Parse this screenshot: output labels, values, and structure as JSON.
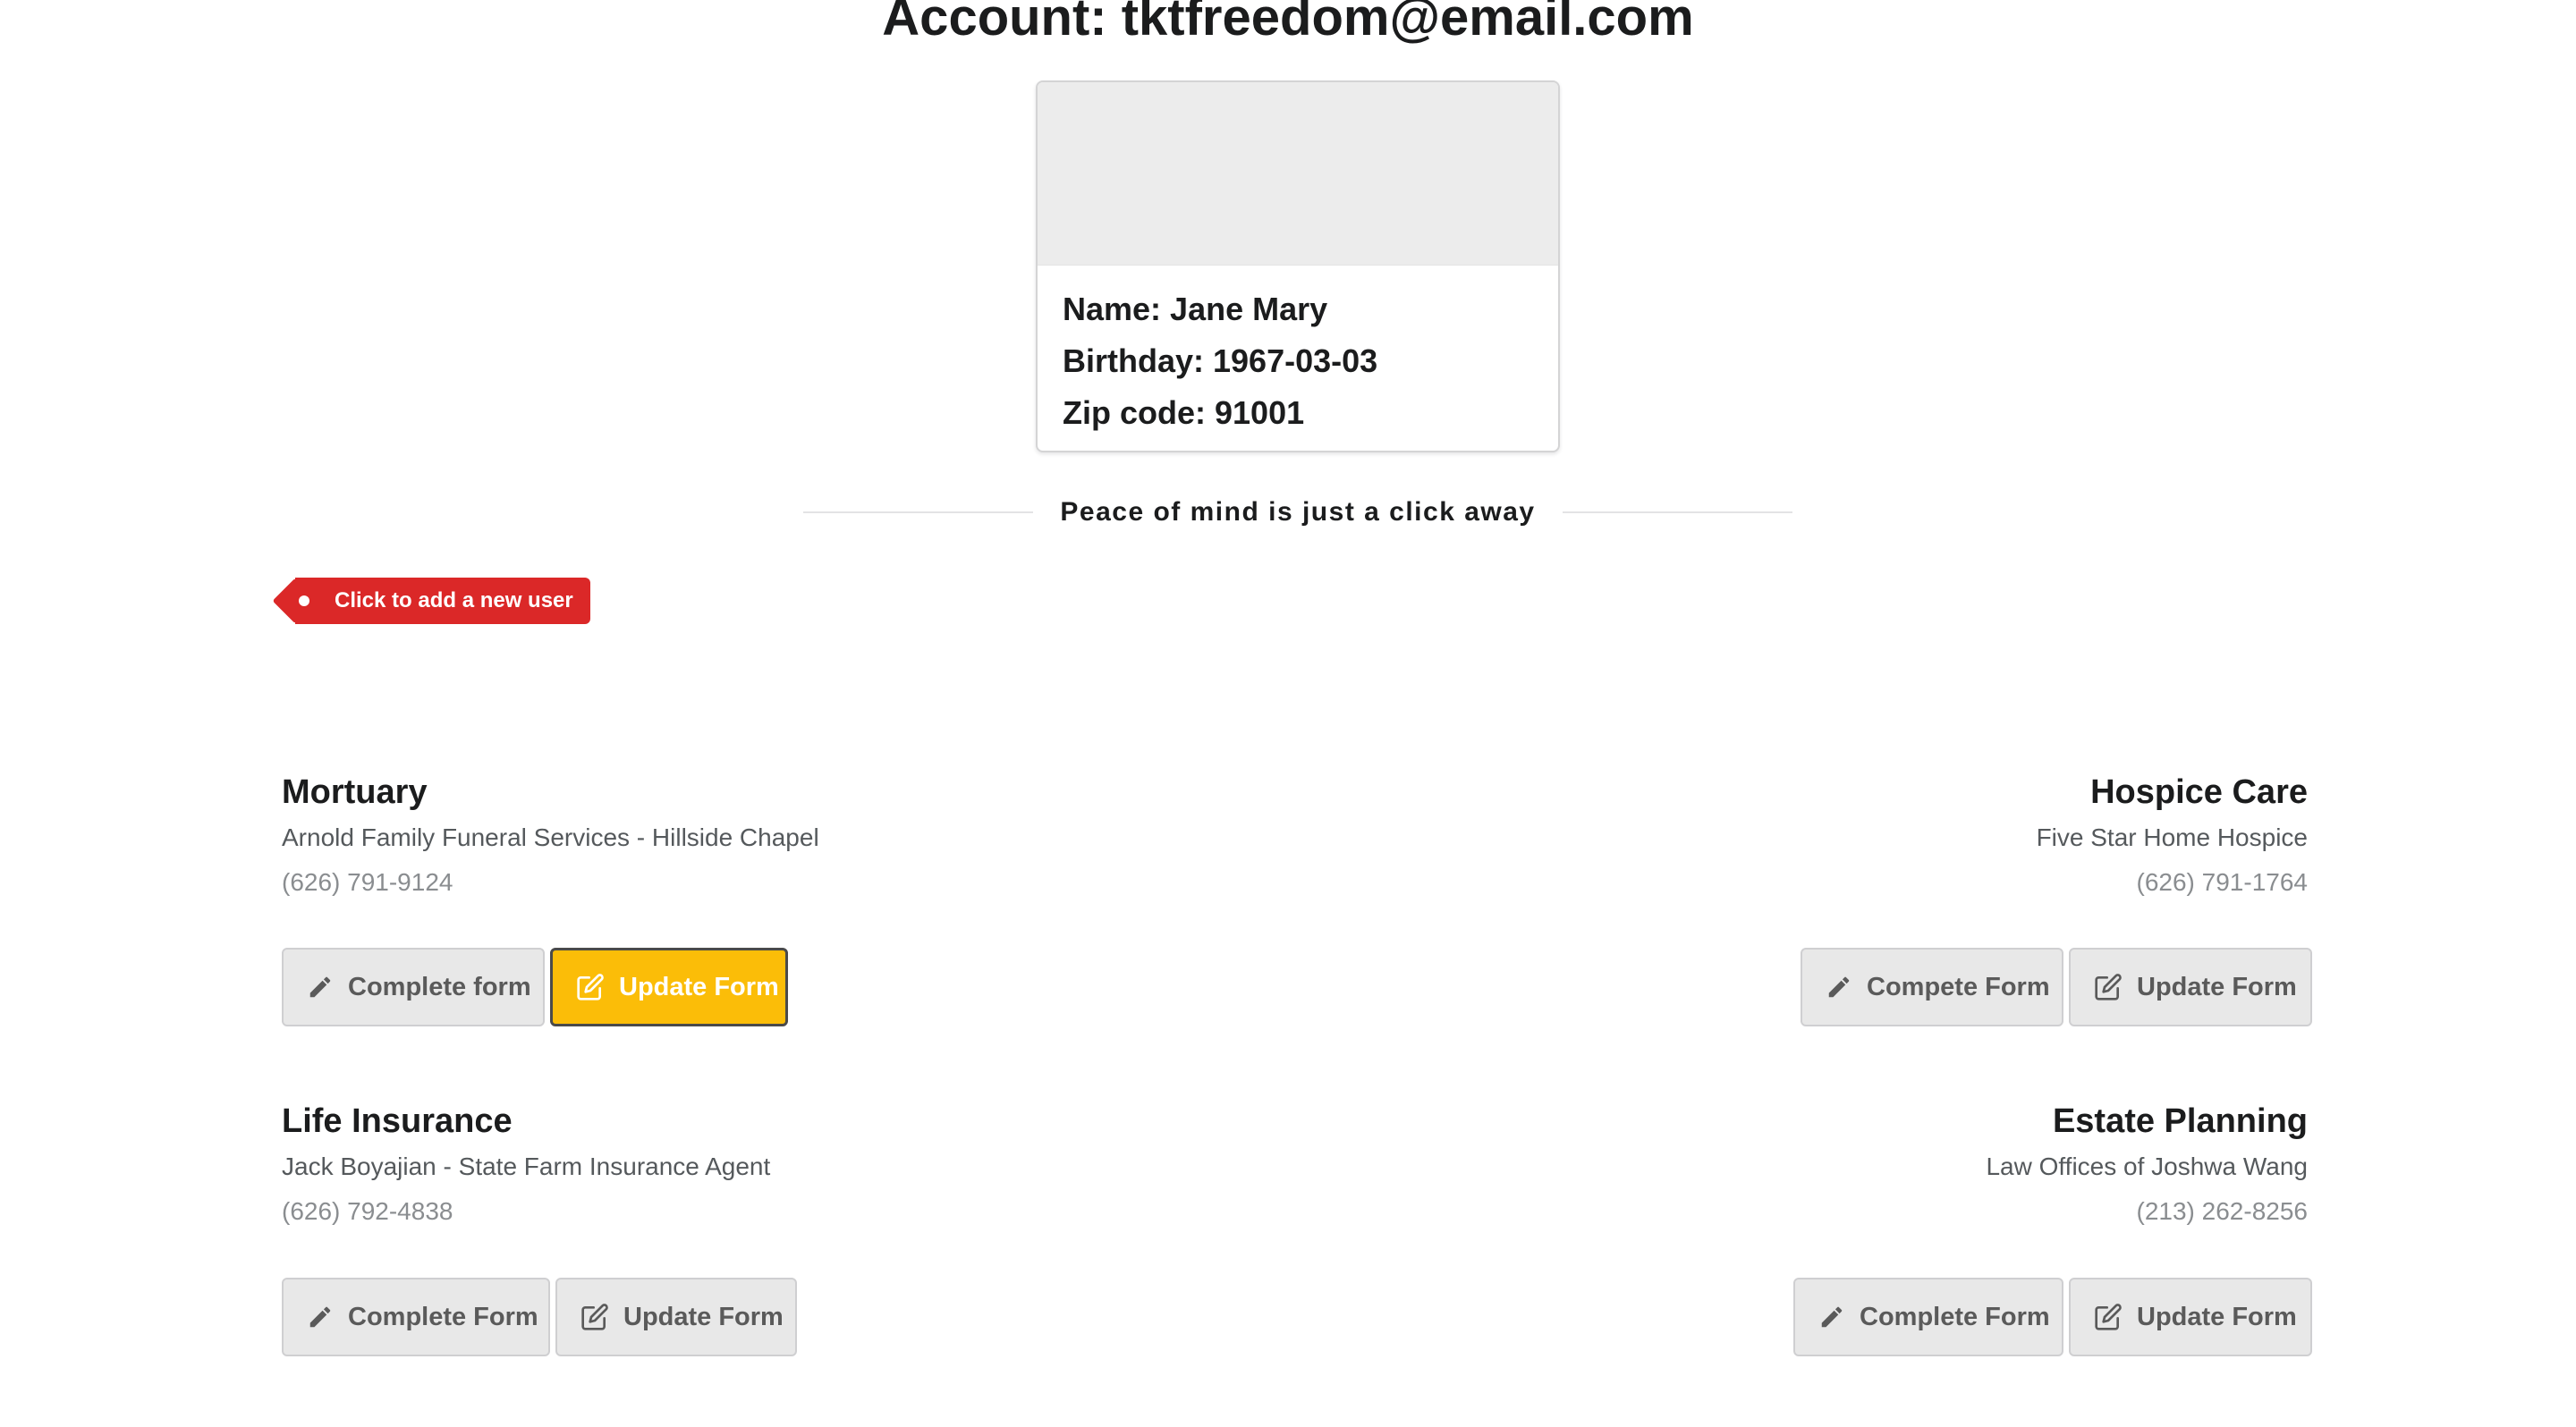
{
  "account": {
    "title": "Account: tktfreedom@email.com"
  },
  "profile": {
    "name": "Name: Jane Mary",
    "birthday": "Birthday: 1967-03-03",
    "zip": "Zip code: 91001"
  },
  "divider": {
    "text": "Peace of mind is just a click away"
  },
  "add_user": {
    "label": "Click to add a new user",
    "color": "#db2828"
  },
  "services": {
    "mortuary": {
      "title": "Mortuary",
      "company": "Arnold Family Funeral Services - Hillside Chapel",
      "phone": "(626) 791-9124",
      "complete_label": "Complete form",
      "update_label": "Update Form"
    },
    "hospice": {
      "title": "Hospice Care",
      "company": "Five Star Home Hospice",
      "phone": "(626) 791-1764",
      "complete_label": "Compete Form",
      "update_label": "Update Form"
    },
    "life_insurance": {
      "title": "Life Insurance",
      "company": "Jack Boyajian - State Farm Insurance Agent",
      "phone": "(626) 792-4838",
      "complete_label": "Complete Form",
      "update_label": "Update Form"
    },
    "estate": {
      "title": "Estate Planning",
      "company": "Law Offices of Joshwa Wang",
      "phone": "(213) 262-8256",
      "complete_label": "Complete Form",
      "update_label": "Update Form"
    }
  },
  "colors": {
    "active_button": "#fbbd08",
    "button_bg": "#e8e8e8"
  },
  "icons": {
    "complete": "pencil-icon",
    "update": "edit-icon"
  }
}
